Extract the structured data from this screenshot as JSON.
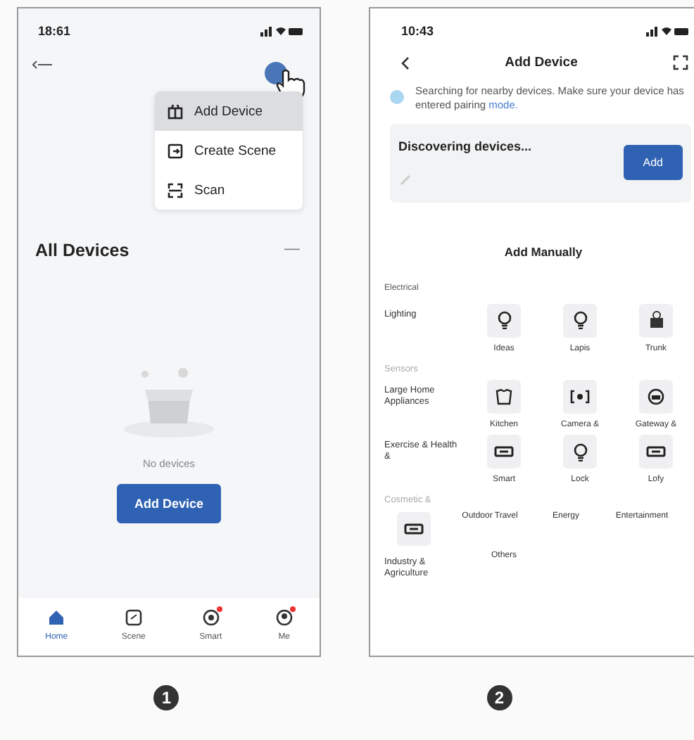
{
  "phone_1": {
    "status_bar": {
      "time": "18:61"
    },
    "menu": [
      {
        "label": "Add Device",
        "selected": true
      },
      {
        "label": "Create Scene",
        "selected": false
      },
      {
        "label": "Scan",
        "selected": false
      }
    ],
    "section_title": "All Devices",
    "collapse": "—",
    "empty_text": "No devices",
    "add_button": "Add Device",
    "tabs": [
      {
        "label": "Home",
        "selected": true,
        "badge": false
      },
      {
        "label": "Scene",
        "selected": false,
        "badge": false
      },
      {
        "label": "Smart",
        "selected": false,
        "badge": true
      },
      {
        "label": "Me",
        "selected": false,
        "badge": true
      }
    ]
  },
  "phone_2": {
    "status_bar": {
      "time": "10:43"
    },
    "title": "Add Device",
    "notice": "Searching for nearby devices. Make sure your device has entered pairing **mode.**",
    "discover_title": "Discovering devices...",
    "add_button": "Add",
    "manual_title": "Add Manually",
    "group_title": "Electrical",
    "rows": [
      {
        "label": "Lighting",
        "muted": false,
        "tiles": [
          {
            "label": "Ideas",
            "kind": "bulb"
          },
          {
            "label": "Lapis",
            "kind": "bulb"
          },
          {
            "label": "Trunk",
            "kind": "socket"
          }
        ]
      },
      {
        "label": "Sensors",
        "muted": true,
        "tiles": []
      },
      {
        "label": "Large Home Appliances",
        "muted": false,
        "tiles": [
          {
            "label": "Kitchen",
            "kind": "shirt"
          },
          {
            "label": "Camera &",
            "kind": "camera"
          },
          {
            "label": "Gateway &",
            "kind": "gateway"
          }
        ]
      },
      {
        "label": "Exercise & Health &",
        "muted": false,
        "tiles": [
          {
            "label": "Smart",
            "kind": "grid"
          },
          {
            "label": "Lock",
            "kind": "bulb"
          },
          {
            "label": "Lofy",
            "kind": "grid"
          }
        ]
      },
      {
        "label": "Cosmetic &",
        "muted": true,
        "tiles": []
      },
      {
        "tiles": [
          {
            "kind": "grid"
          },
          {
            "label": "Outdoor Travel",
            "kind": "text"
          },
          {
            "label": "Energy",
            "kind": "text"
          },
          {
            "label": "Entertainment",
            "kind": "text"
          }
        ]
      },
      {
        "label": "Industry & Agriculture",
        "muted": false,
        "tiles": [
          {
            "label": "Others",
            "kind": "text"
          }
        ]
      }
    ]
  },
  "markers": [
    "1",
    "2"
  ]
}
